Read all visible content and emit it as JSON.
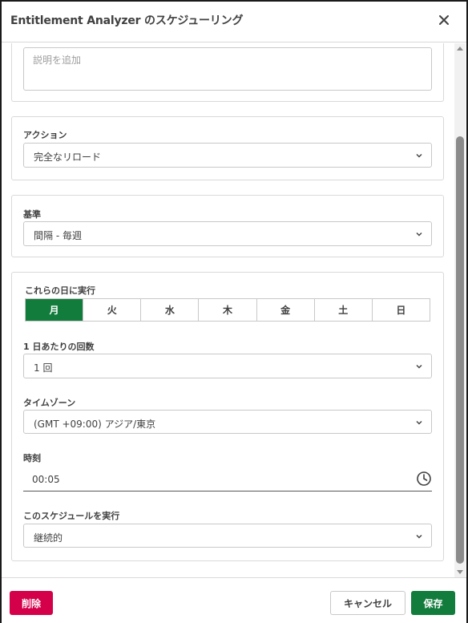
{
  "dialog": {
    "title": "Entitlement Analyzer のスケジューリング"
  },
  "description": {
    "placeholder": "説明を追加"
  },
  "action": {
    "label": "アクション",
    "value": "完全なリロード"
  },
  "basis": {
    "label": "基準",
    "value": "間隔 - 毎週"
  },
  "schedule": {
    "days_label": "これらの日に実行",
    "days": [
      {
        "label": "月",
        "selected": true
      },
      {
        "label": "火",
        "selected": false
      },
      {
        "label": "水",
        "selected": false
      },
      {
        "label": "木",
        "selected": false
      },
      {
        "label": "金",
        "selected": false
      },
      {
        "label": "土",
        "selected": false
      },
      {
        "label": "日",
        "selected": false
      }
    ],
    "times_per_day_label": "1 日あたりの回数",
    "times_per_day_value": "1 回",
    "timezone_label": "タイムゾーン",
    "timezone_value": "(GMT +09:00) アジア/東京",
    "time_label": "時刻",
    "time_value": "00:05",
    "run_label": "このスケジュールを実行",
    "run_value": "継続的"
  },
  "footer": {
    "delete_label": "削除",
    "cancel_label": "キャンセル",
    "save_label": "保存"
  },
  "colors": {
    "primary_green": "#117c3c",
    "danger_red": "#d4004a",
    "border": "#c8c8c8",
    "text": "#404040"
  }
}
